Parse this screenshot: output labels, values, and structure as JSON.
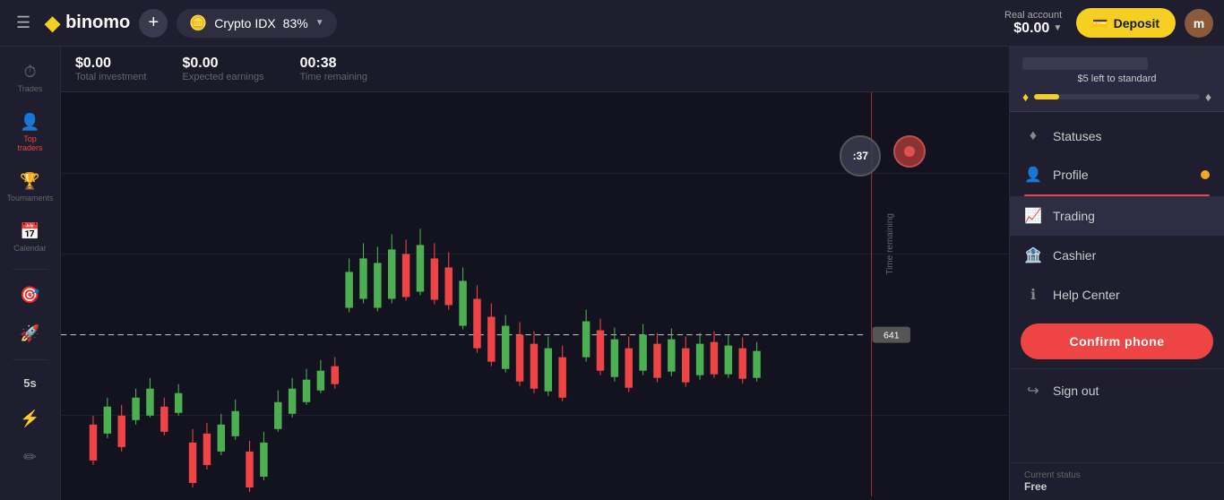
{
  "header": {
    "hamburger_icon": "☰",
    "logo_text": "binomo",
    "logo_icon": "◆",
    "add_button_label": "+",
    "asset": {
      "icon": "🪙",
      "name": "Crypto IDX",
      "percent": "83%",
      "caret": "▼"
    },
    "account": {
      "label": "Real account",
      "balance": "$0.00",
      "caret": "▼"
    },
    "deposit_icon": "💳",
    "deposit_label": "Deposit",
    "avatar_initial": "m"
  },
  "left_sidebar": {
    "items": [
      {
        "id": "trades",
        "icon": "⏱",
        "label": "Trades",
        "active": false
      },
      {
        "id": "top-traders",
        "icon": "👤",
        "label": "Top traders",
        "active": true
      },
      {
        "id": "tournaments",
        "icon": "🏆",
        "label": "Tournaments",
        "active": false
      },
      {
        "id": "calendar",
        "icon": "📅",
        "label": "Calendar",
        "active": false
      },
      {
        "id": "achievements",
        "icon": "🎯",
        "label": "",
        "active": false
      },
      {
        "id": "launch",
        "icon": "🚀",
        "label": "",
        "active": false
      },
      {
        "id": "5s",
        "label": "5s",
        "active": false
      },
      {
        "id": "indicators",
        "icon": "⚡",
        "label": "",
        "active": false
      },
      {
        "id": "draw",
        "icon": "✏",
        "label": "",
        "active": false
      }
    ]
  },
  "chart": {
    "stats": [
      {
        "id": "investment",
        "value": "$0.00",
        "label": "Total investment"
      },
      {
        "id": "earnings",
        "value": "$0.00",
        "label": "Expected earnings"
      },
      {
        "id": "time",
        "value": "00:38",
        "label": "Time remaining"
      }
    ],
    "timer_value": ":37",
    "price_value": "641",
    "time_remaining_label": "Time remaining",
    "interval_label": "5s"
  },
  "right_panel": {
    "progress_text": "$5 left to standard",
    "diamond_left": "♦",
    "diamond_right": "♦",
    "progress_percent": 15,
    "menu_items": [
      {
        "id": "statuses",
        "icon": "♦",
        "label": "Statuses",
        "badge": false
      },
      {
        "id": "profile",
        "icon": "👤",
        "label": "Profile",
        "badge": true
      },
      {
        "id": "trading",
        "icon": "📈",
        "label": "Trading",
        "active": true
      },
      {
        "id": "cashier",
        "icon": "🏦",
        "label": "Cashier",
        "badge": false
      },
      {
        "id": "help-center",
        "icon": "ℹ",
        "label": "Help Center",
        "badge": false
      }
    ],
    "confirm_phone_label": "Confirm phone",
    "sign_out": {
      "icon": "→",
      "label": "Sign out"
    },
    "status": {
      "label": "Current status",
      "value": "Free"
    }
  }
}
